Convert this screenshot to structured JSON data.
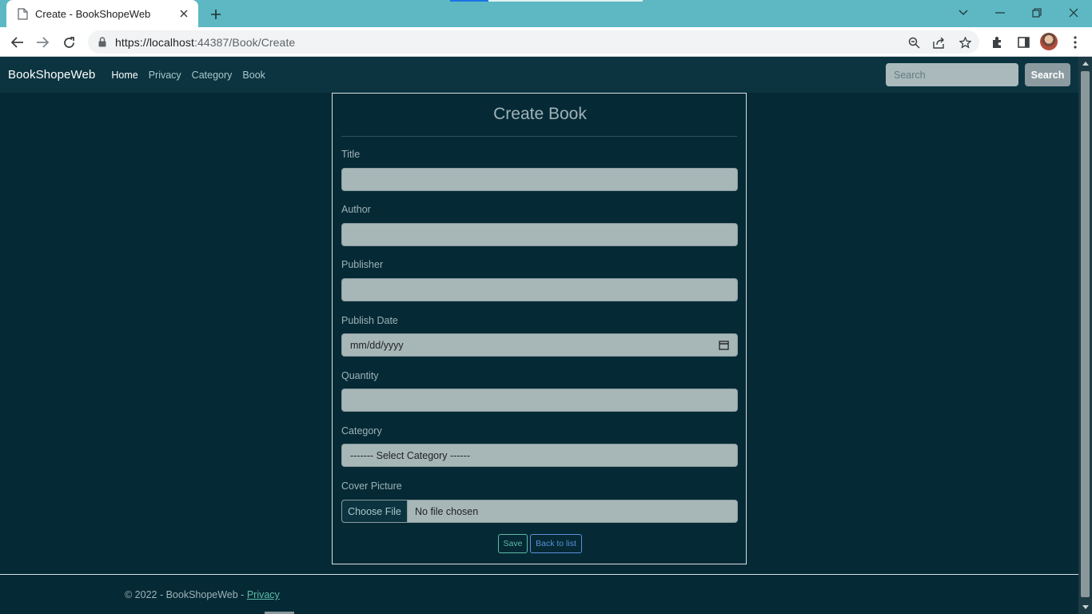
{
  "browser": {
    "tab_title": "Create - BookShopeWeb",
    "url_host": "https://localhost",
    "url_rest": ":44387/Book/Create"
  },
  "navbar": {
    "brand": "BookShopeWeb",
    "links": [
      "Home",
      "Privacy",
      "Category",
      "Book"
    ],
    "active_link": "Home",
    "search_placeholder": "Search",
    "search_button": "Search"
  },
  "form": {
    "heading": "Create Book",
    "fields": {
      "title": {
        "label": "Title",
        "value": ""
      },
      "author": {
        "label": "Author",
        "value": ""
      },
      "publisher": {
        "label": "Publisher",
        "value": ""
      },
      "publish_date": {
        "label": "Publish Date",
        "value": "mm/dd/yyyy"
      },
      "quantity": {
        "label": "Quantity",
        "value": ""
      },
      "category": {
        "label": "Category",
        "selected": "------- Select Category ------"
      },
      "cover_picture": {
        "label": "Cover Picture",
        "button": "Choose File",
        "status": "No file chosen"
      }
    },
    "save_button": "Save",
    "back_button": "Back to list"
  },
  "footer": {
    "text": "© 2022 - BookShopeWeb - ",
    "link": "Privacy"
  },
  "colors": {
    "page_bg": "#052a35",
    "navbar_bg": "#0b3440",
    "input_bg": "#a7b7b8",
    "tabstrip": "#5db8c3",
    "save_accent": "#5fbaa6",
    "back_accent": "#5b8fd9"
  }
}
